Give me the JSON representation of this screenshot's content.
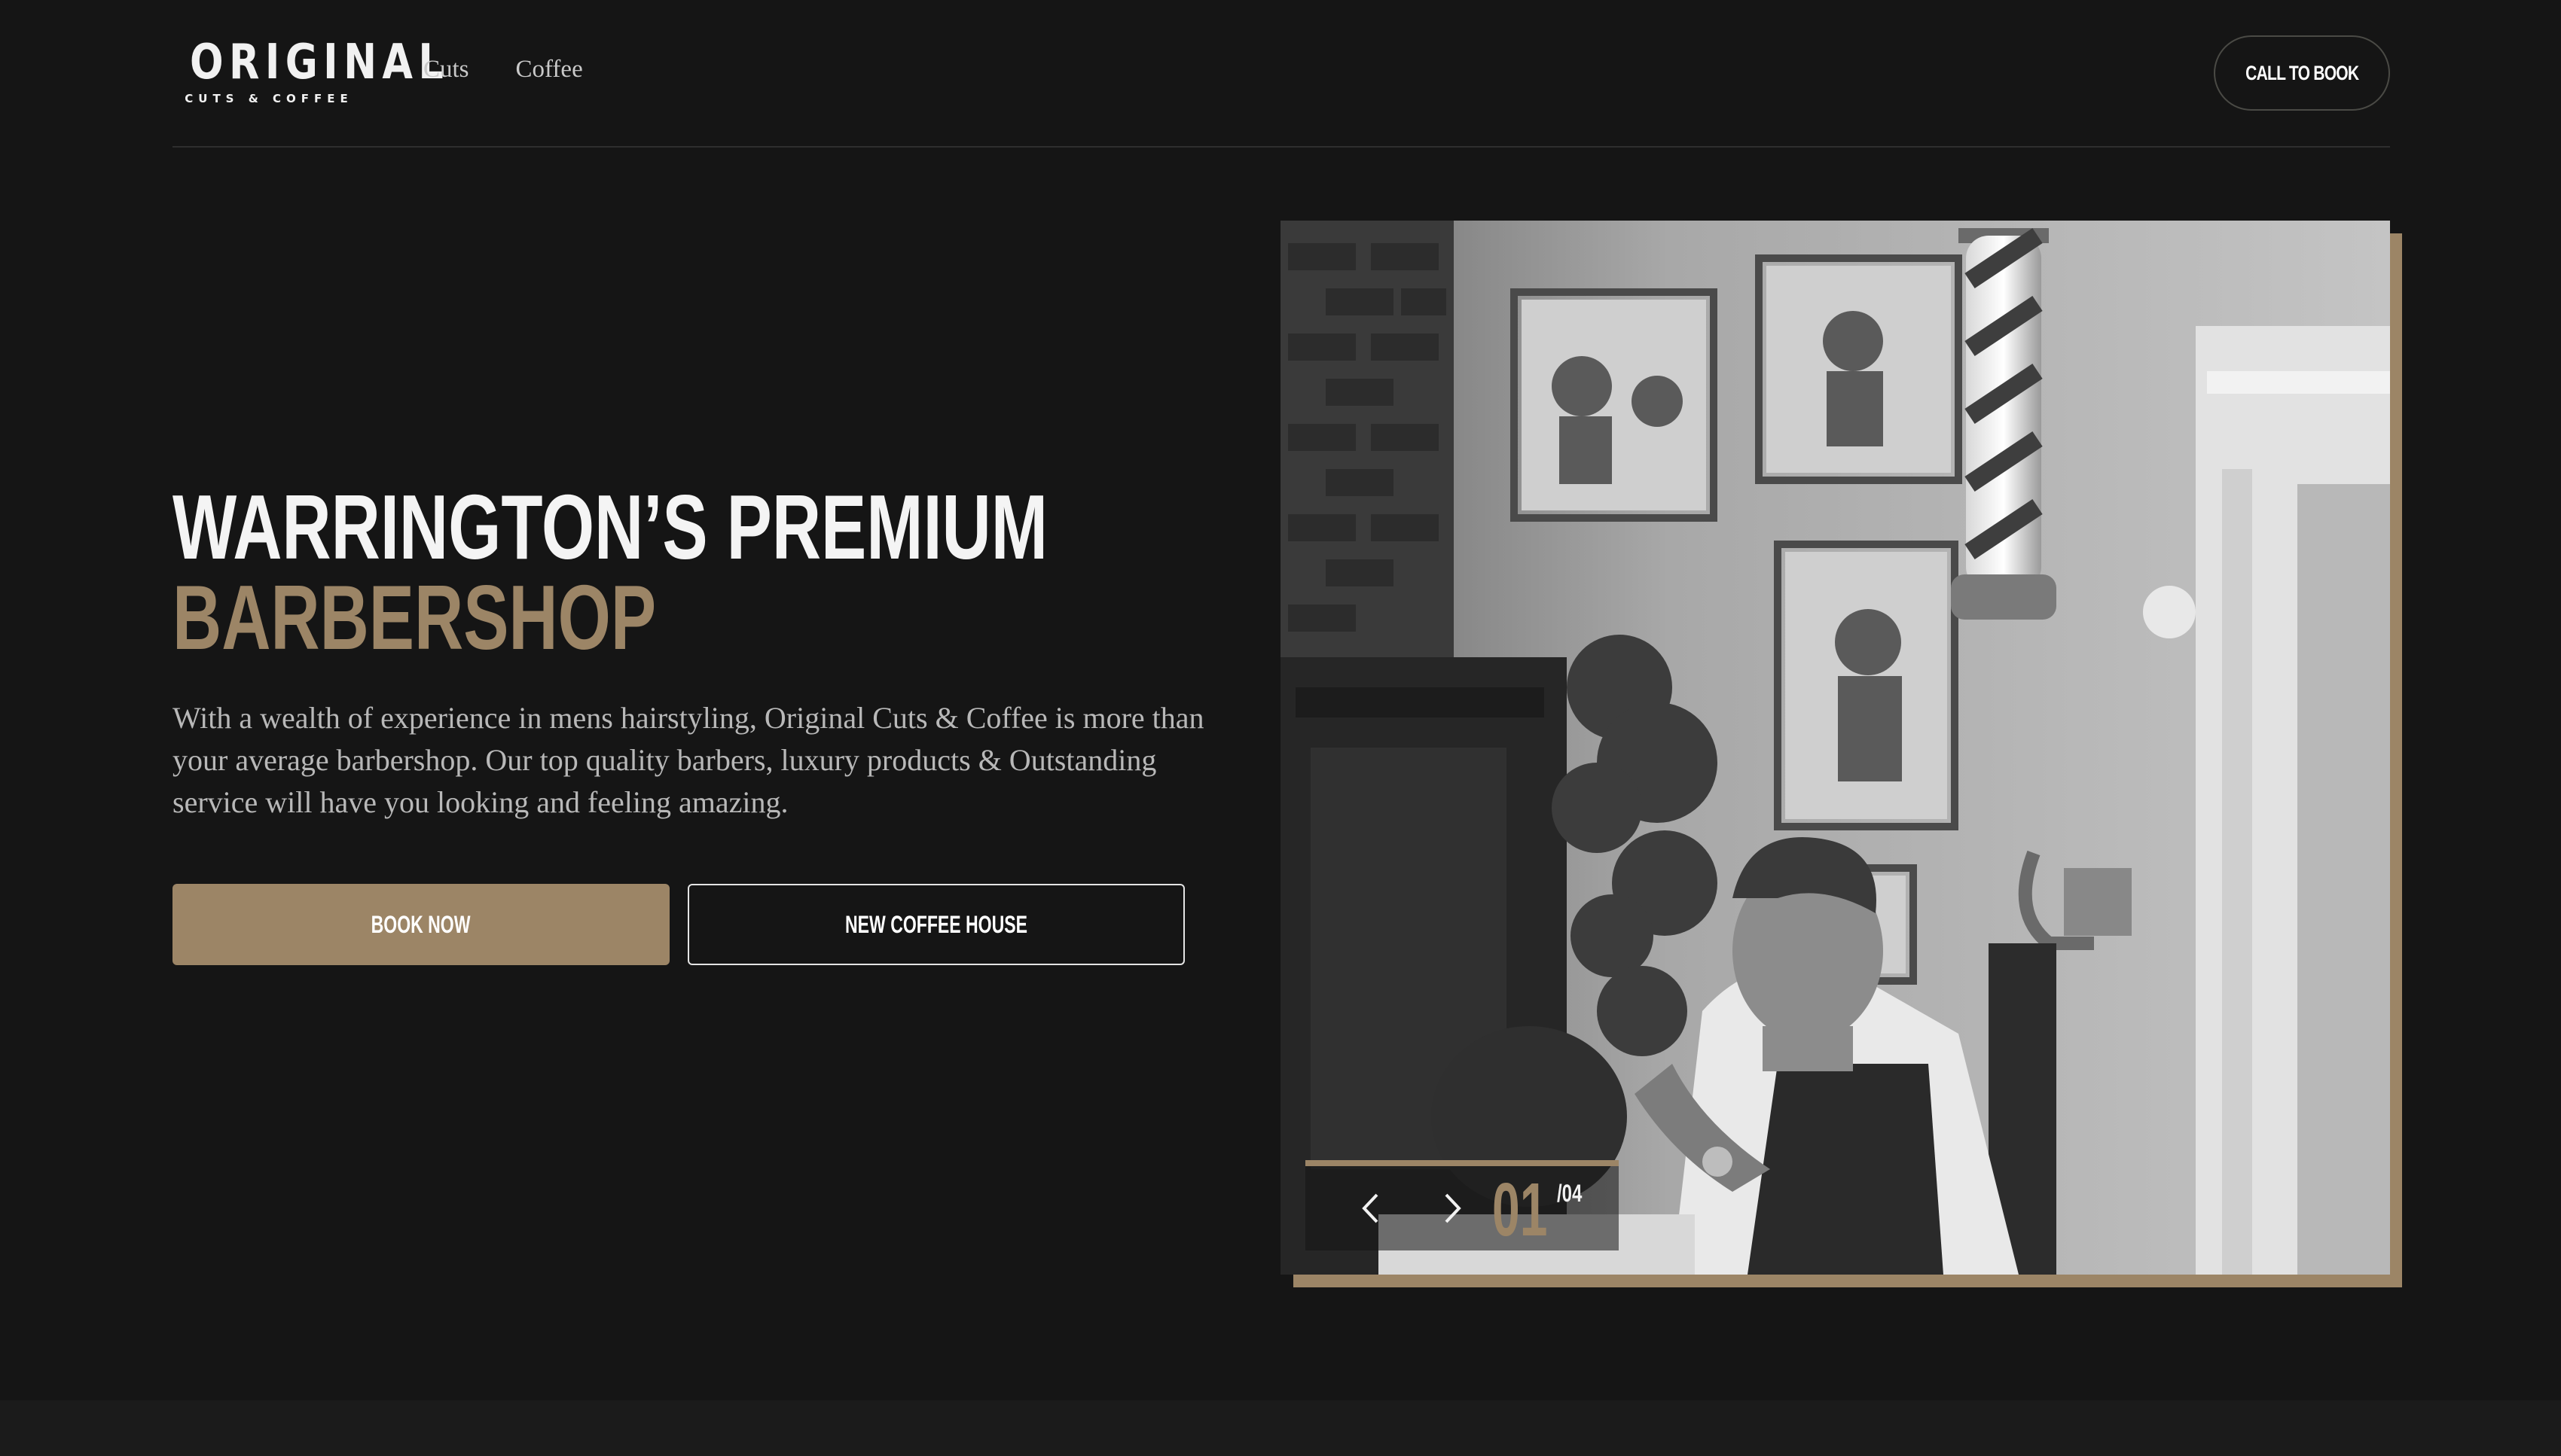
{
  "brand": {
    "name": "ORIGINAL",
    "tagline": "CUTS & COFFEE"
  },
  "nav": {
    "items": [
      "Cuts",
      "Coffee"
    ],
    "call_label": "CALL TO BOOK"
  },
  "hero": {
    "title_line1": "WARRINGTON’S PREMIUM",
    "title_line2": "BARBERSHOP",
    "description": "With a wealth of experience in mens hairstyling, Original Cuts & Coffee is more than your average barbershop. Our top quality barbers, luxury products & Outstanding service will have you looking and feeling amazing.",
    "book_label": "BOOK NOW",
    "coffee_label": "NEW COFFEE HOUSE"
  },
  "slider": {
    "current": "01",
    "total": "/04",
    "prev_icon": "chevron-left-icon",
    "next_icon": "chevron-right-icon"
  },
  "colors": {
    "background": "#151515",
    "accent": "#9c8566",
    "text": "#f4f4f4",
    "muted": "#b8b8b8"
  }
}
